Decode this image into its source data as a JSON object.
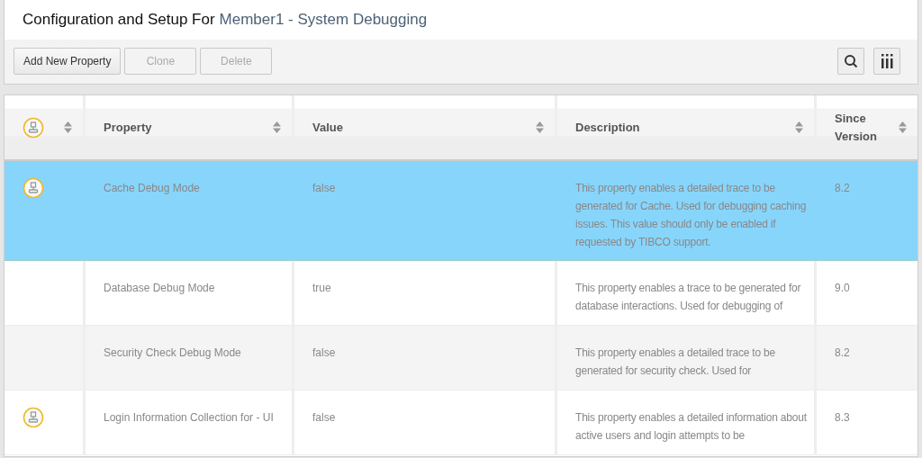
{
  "header": {
    "title": "Configuration and Setup For",
    "subject": "Member1 - System Debugging"
  },
  "toolbar": {
    "buttons": [
      {
        "label": "Add New Property",
        "disabled": false
      },
      {
        "label": "Clone",
        "disabled": true
      },
      {
        "label": "Delete",
        "disabled": true
      }
    ],
    "icon_buttons": [
      {
        "kind": "search"
      },
      {
        "kind": "columns"
      }
    ]
  },
  "table": {
    "columns": [
      {
        "kind": "icon"
      },
      {
        "label": "Property",
        "kind": "text"
      },
      {
        "label": "Value",
        "kind": "text"
      },
      {
        "label": "Description",
        "kind": "text"
      },
      {
        "label": "Since Version",
        "kind": "text"
      }
    ],
    "rows": [
      {
        "selected": true,
        "node_icon": true,
        "property": "Cache Debug Mode",
        "value": "false",
        "description": "This property enables a detailed trace to be generated for Cache. Used for debugging caching issues. This value should only be enabled if requested by TIBCO support.",
        "since_version": "8.2"
      },
      {
        "selected": false,
        "node_icon": false,
        "property": "Database Debug Mode",
        "value": "true",
        "description": "This property enables a trace to be generated for database interactions. Used for debugging of",
        "since_version": "9.0"
      },
      {
        "selected": false,
        "node_icon": false,
        "property": "Security Check Debug Mode",
        "value": "false",
        "description": "This property enables a detailed trace to be generated for security check. Used for",
        "since_version": "8.2"
      },
      {
        "selected": false,
        "node_icon": true,
        "property": "Login Information Collection for - UI",
        "value": "false",
        "description": "This property enables a detailed information about active users and login attempts to be",
        "since_version": "8.3"
      }
    ]
  }
}
